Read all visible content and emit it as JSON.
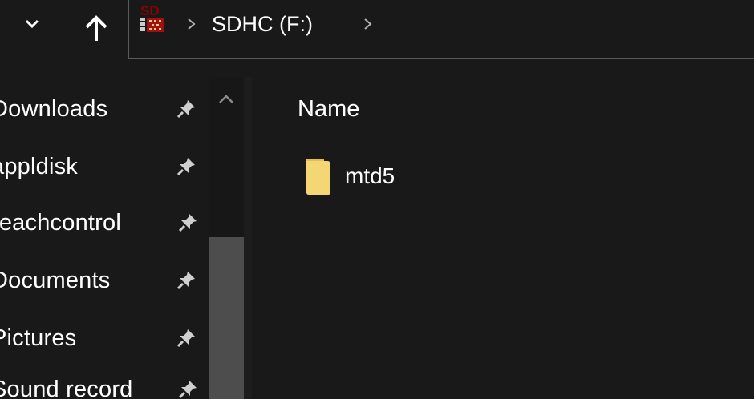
{
  "address_bar": {
    "drive_icon_text": "SD",
    "breadcrumbs": [
      "SDHC (F:)"
    ]
  },
  "nav_pane": {
    "items": [
      {
        "label": "Downloads",
        "pinned": true
      },
      {
        "label": "appldisk",
        "pinned": true
      },
      {
        "label": "reachcontrol",
        "pinned": true
      },
      {
        "label": "Documents",
        "pinned": true
      },
      {
        "label": "Pictures",
        "pinned": true
      },
      {
        "label": "Sound record",
        "pinned": true
      }
    ]
  },
  "content": {
    "column_header": "Name",
    "files": [
      {
        "name": "mtd5",
        "type": "folder"
      }
    ]
  },
  "icons": {
    "recent": "chevron-down-icon",
    "up": "arrow-up-icon",
    "separator": "chevron-right-icon",
    "pin": "pin-icon",
    "folder": "folder-icon",
    "drive": "sd-card-drive-icon"
  },
  "colors": {
    "background": "#191919",
    "text": "#ffffff",
    "folder": "#f4d675",
    "scroll_thumb": "#4d4d4d",
    "drive_red": "#8b0000"
  }
}
